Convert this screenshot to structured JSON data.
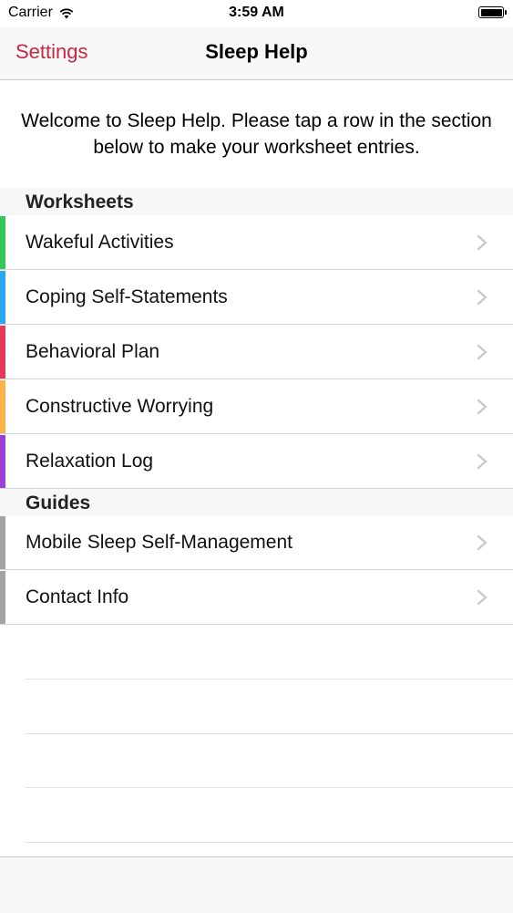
{
  "status_bar": {
    "carrier": "Carrier",
    "time": "3:59 AM"
  },
  "nav": {
    "back_label": "Settings",
    "title": "Sleep Help"
  },
  "welcome_text": "Welcome to Sleep Help. Please tap a row in the section below to make your worksheet entries.",
  "colors": {
    "accent": "#c8273f",
    "wakeful": "#34c759",
    "coping": "#2aa9f0",
    "behavioral": "#e8365d",
    "constructive": "#fdb34a",
    "relaxation": "#9b3fd6",
    "guides": "#a3a3a3"
  },
  "sections": {
    "worksheets": {
      "header": "Worksheets",
      "items": [
        {
          "label": "Wakeful Activities"
        },
        {
          "label": "Coping Self-Statements"
        },
        {
          "label": "Behavioral Plan"
        },
        {
          "label": "Constructive Worrying"
        },
        {
          "label": "Relaxation Log"
        }
      ]
    },
    "guides": {
      "header": "Guides",
      "items": [
        {
          "label": "Mobile Sleep Self-Management"
        },
        {
          "label": "Contact Info"
        }
      ]
    }
  }
}
